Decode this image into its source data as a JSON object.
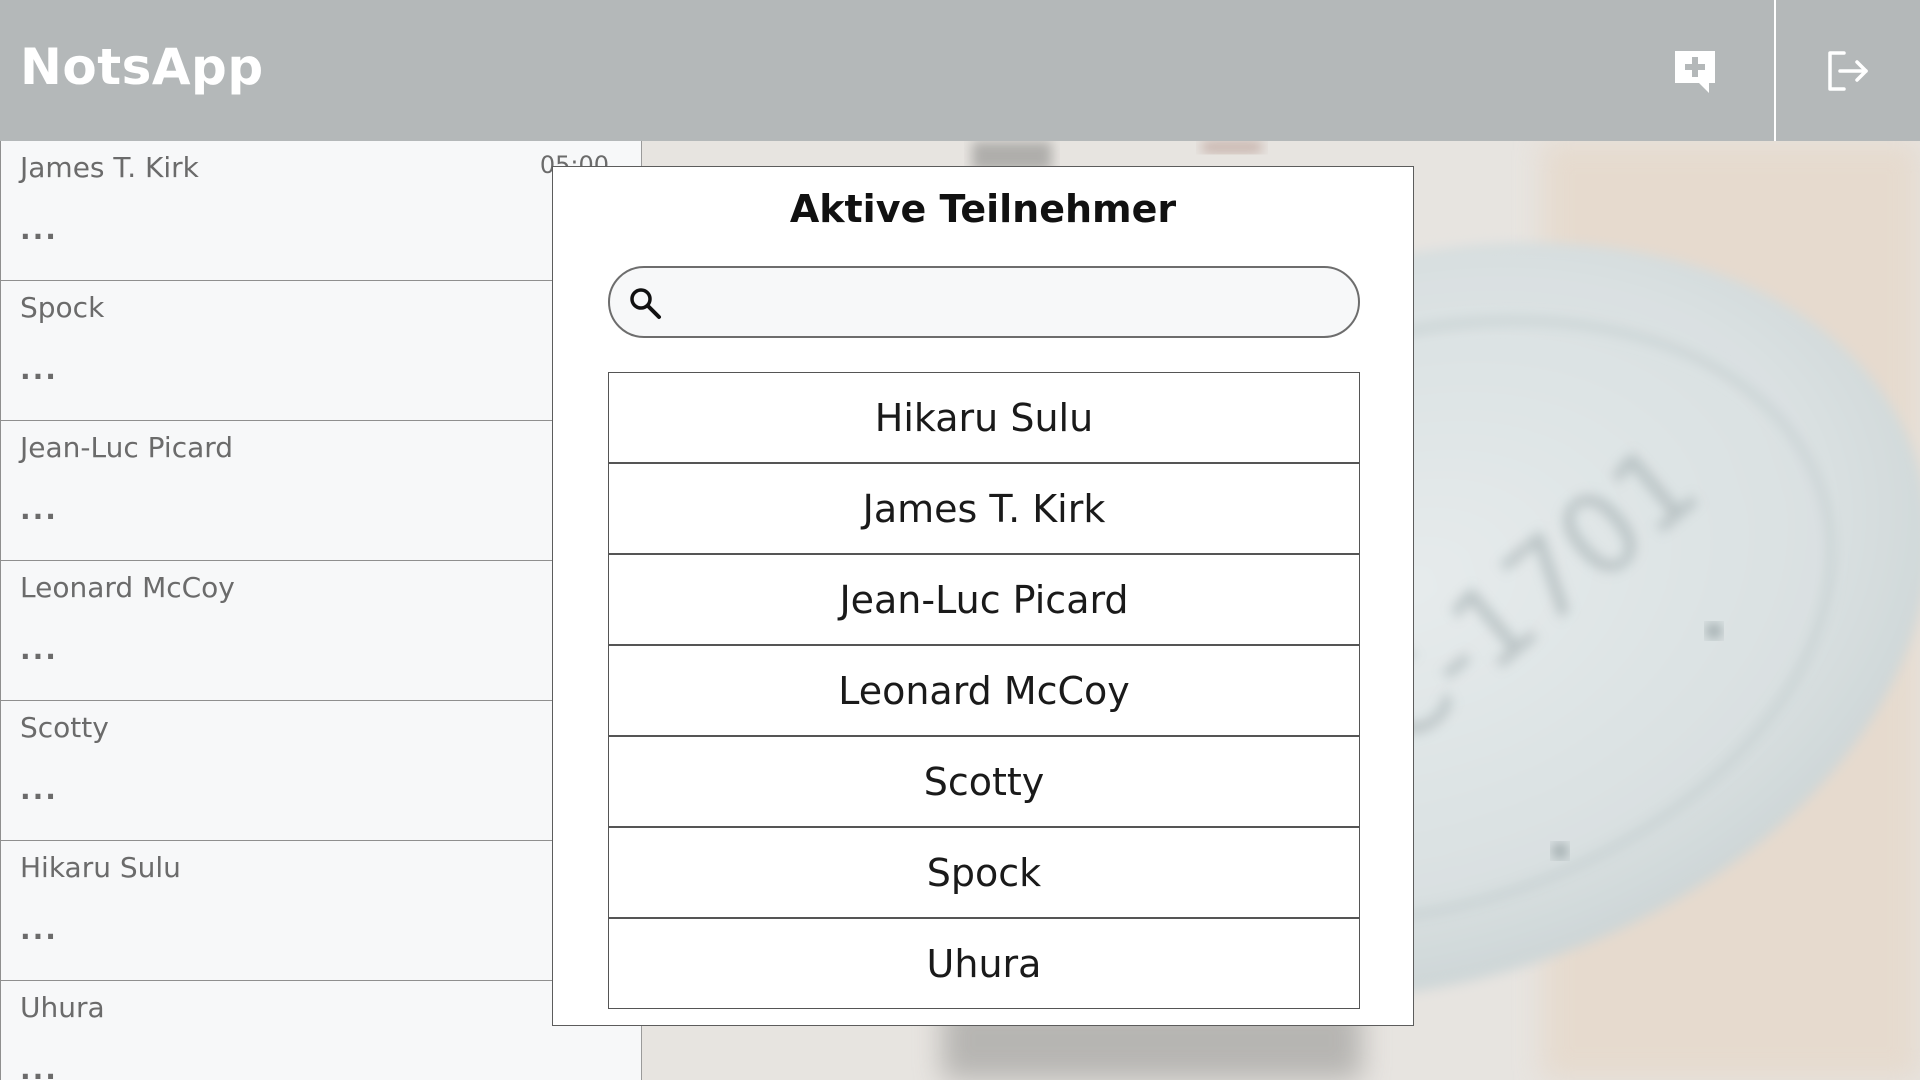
{
  "app": {
    "title": "NotsApp"
  },
  "header": {
    "new_chat_icon": "new-chat-icon",
    "logout_icon": "logout-icon"
  },
  "colors": {
    "header_bg": "#b4b8b9",
    "list_bg": "#f7f8f9",
    "accent_text": "#ffffff"
  },
  "contacts": [
    {
      "name": "James T. Kirk",
      "preview": "...",
      "time": "05:00"
    },
    {
      "name": "Spock",
      "preview": "..."
    },
    {
      "name": "Jean-Luc Picard",
      "preview": "..."
    },
    {
      "name": "Leonard McCoy",
      "preview": "..."
    },
    {
      "name": "Scotty",
      "preview": "..."
    },
    {
      "name": "Hikaru Sulu",
      "preview": "..."
    },
    {
      "name": "Uhura",
      "preview": "..."
    }
  ],
  "modal": {
    "title": "Aktive Teilnehmer",
    "search": {
      "value": "",
      "placeholder": ""
    },
    "participants": [
      "Hikaru Sulu",
      "James T. Kirk",
      "Jean-Luc Picard",
      "Leonard McCoy",
      "Scotty",
      "Spock",
      "Uhura"
    ]
  },
  "background": {
    "image_text": "C-1701"
  }
}
